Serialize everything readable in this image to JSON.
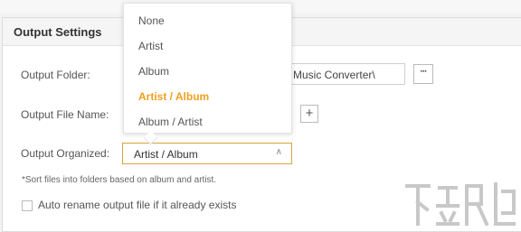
{
  "panel": {
    "title": "Output Settings"
  },
  "fields": {
    "output_folder_label": "Output Folder:",
    "output_folder_value": "Music Converter\\",
    "browse_label": "···",
    "output_file_name_label": "Output File Name:",
    "add_label": "+",
    "output_organized_label": "Output Organized:",
    "output_organized_value": "Artist / Album",
    "caret": "∧"
  },
  "dropdown": {
    "options": [
      "None",
      "Artist",
      "Album",
      "Artist / Album",
      "Album / Artist"
    ],
    "selected": "Artist / Album"
  },
  "note": "*Sort files into folders based on album and artist.",
  "auto_rename": {
    "label": "Auto rename output file if it already exists",
    "checked": false
  },
  "colors": {
    "accent": "#f0a020",
    "border_focus": "#d9a23f"
  }
}
